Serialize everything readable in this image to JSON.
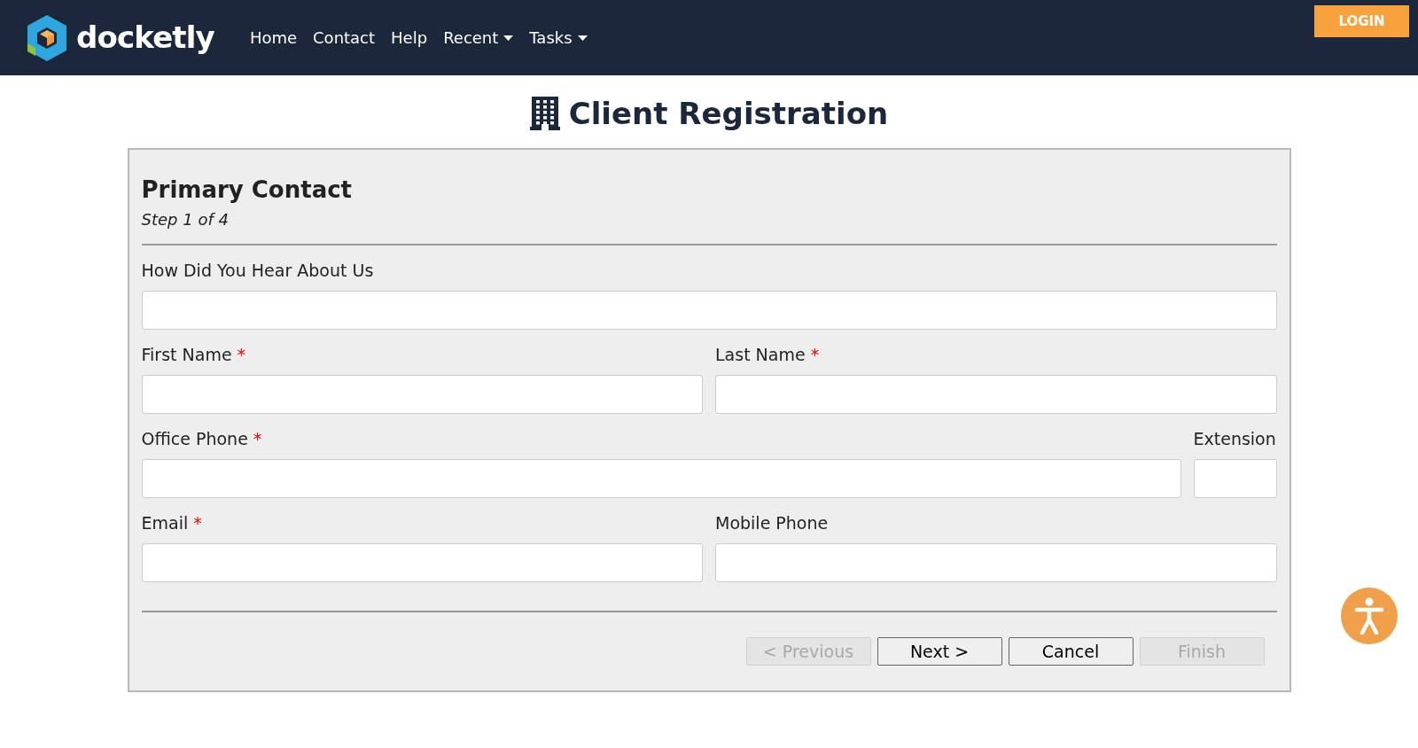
{
  "header": {
    "brand": "docketly",
    "nav": [
      {
        "label": "Home",
        "dropdown": false
      },
      {
        "label": "Contact",
        "dropdown": false
      },
      {
        "label": "Help",
        "dropdown": false
      },
      {
        "label": "Recent",
        "dropdown": true
      },
      {
        "label": "Tasks",
        "dropdown": true
      }
    ],
    "login": "LOGIN"
  },
  "page_title": "Client Registration",
  "form": {
    "title": "Primary Contact",
    "step": "Step 1 of 4",
    "rows": [
      [
        {
          "label": "How Did You Hear About Us",
          "kind": "full"
        }
      ],
      [
        {
          "label": "First Name",
          "required_mark": "*",
          "kind": "half"
        },
        {
          "label": "Last Name",
          "required_mark": "*",
          "kind": "half"
        }
      ],
      [
        {
          "label": "Office Phone",
          "required_mark": "*",
          "kind": "wide"
        },
        {
          "label": "Extension",
          "kind": "narrow"
        }
      ],
      [
        {
          "label": "Email",
          "required_mark": "*",
          "kind": "half"
        },
        {
          "label": "Mobile Phone",
          "kind": "half"
        }
      ]
    ],
    "buttons": [
      {
        "label": "< Previous",
        "disabled": true
      },
      {
        "label": "Next >",
        "disabled": false
      },
      {
        "label": "Cancel",
        "disabled": false
      },
      {
        "label": "Finish",
        "disabled": true
      }
    ]
  }
}
